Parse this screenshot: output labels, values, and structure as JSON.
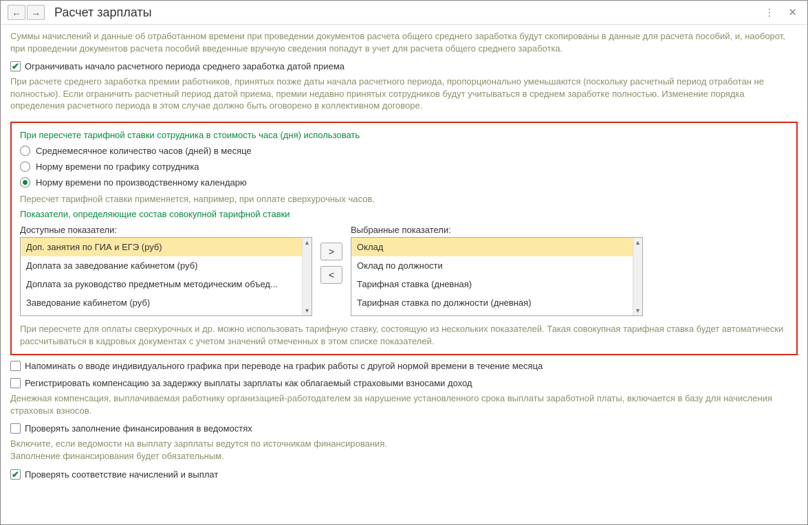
{
  "header": {
    "title": "Расчет зарплаты"
  },
  "intro_text": "Суммы начислений и данные об отработанном времени при проведении документов расчета общего среднего заработка будут скопированы в данные для расчета пособий, и, наоборот, при проведении документов расчета пособий введенные вручную сведения попадут в учет для расчета общего среднего заработка.",
  "limit_check": {
    "label": "Ограничивать начало расчетного периода среднего заработка датой приема"
  },
  "limit_explain": "При расчете среднего заработка премии работников, принятых позже даты начала расчетного периода, пропорционально уменьшаются (поскольку расчетный период отработан не полностью). Если ограничить расчетный период датой приема, премии недавно принятых сотрудников будут учитываться в среднем заработке полностью. Изменение порядка определения расчетного периода в этом случае должно быть оговорено в коллективном договоре.",
  "rate_section": {
    "title": "При пересчете тарифной ставки сотрудника в стоимость часа (дня) использовать",
    "option1": "Среднемесячное количество часов (дней) в месяце",
    "option2": "Норму времени по графику сотрудника",
    "option3": "Норму времени по производственному календарю",
    "note": "Пересчет тарифной ставки применяется, например, при оплате сверхурочных часов."
  },
  "indicators": {
    "title": "Показатели, определяющие состав совокупной тарифной ставки",
    "available_label": "Доступные показатели:",
    "selected_label": "Выбранные показатели:",
    "available": [
      "Доп. занятия по ГИА и ЕГЭ (руб)",
      "Доплата за заведование кабинетом (руб)",
      "Доплата за руководство предметным методическим объед...",
      "Заведование кабинетом (руб)"
    ],
    "selected": [
      "Оклад",
      "Оклад по должности",
      "Тарифная ставка (дневная)",
      "Тарифная ставка по должности (дневная)"
    ],
    "move_right": ">",
    "move_left": "<",
    "note": "При пересчете для оплаты сверхурочных и др. можно использовать тарифную ставку, состоящую из нескольких показателей. Такая совокупная тарифная ставка будет автоматически рассчитываться в кадровых документах с учетом значений отмеченных в этом списке показателей."
  },
  "remind_check": {
    "label": "Напоминать о вводе индивидуального графика при переводе на график работы с другой нормой времени в течение месяца"
  },
  "compensation_check": {
    "label": "Регистрировать компенсацию за задержку выплаты зарплаты как облагаемый страховыми взносами доход"
  },
  "compensation_note": "Денежная компенсация, выплачиваемая работнику организацией-работодателем за нарушение установленного срока выплаты заработной платы, включается в базу для начисления страховых взносов.",
  "financing_check": {
    "label": "Проверять заполнение финансирования в ведомостях"
  },
  "financing_note": "Включите, если ведомости на выплату зарплаты ведутся по источникам финансирования.\nЗаполнение финансирования будет обязательным.",
  "match_check": {
    "label": "Проверять соответствие начислений и выплат"
  }
}
